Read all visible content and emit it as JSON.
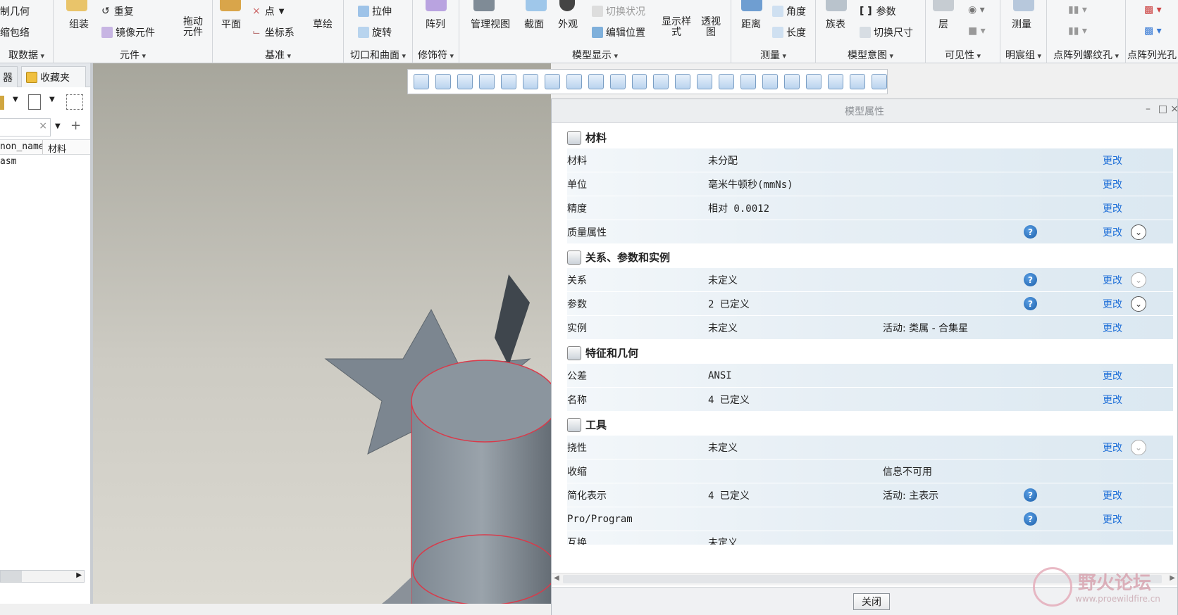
{
  "ribbon": {
    "groups": [
      {
        "label": "取数据",
        "items": [
          "制几何",
          "缩包络"
        ]
      },
      {
        "label": "元件",
        "items": [
          "组装",
          "重复",
          "镜像元件",
          "拖动元件"
        ]
      },
      {
        "label": "基准",
        "items": [
          "平面",
          "点",
          "坐标系",
          "草绘"
        ]
      },
      {
        "label": "切口和曲面",
        "items": [
          "拉伸",
          "旋转"
        ]
      },
      {
        "label": "修饰符",
        "items": [
          "阵列"
        ]
      },
      {
        "label": "模型显示",
        "items": [
          "管理视图",
          "截面",
          "外观",
          "切换状况",
          "编辑位置",
          "显示样式",
          "透视图"
        ]
      },
      {
        "label": "测量",
        "items": [
          "距离",
          "角度",
          "长度"
        ]
      },
      {
        "label": "模型意图",
        "items": [
          "族表",
          "参数",
          "切换尺寸"
        ]
      },
      {
        "label": "可见性",
        "items": [
          "层"
        ]
      },
      {
        "label": "明宸组",
        "items": [
          "测量"
        ]
      },
      {
        "label": "点阵列螺纹孔",
        "items": []
      },
      {
        "label": "点阵列光孔",
        "items": []
      }
    ]
  },
  "left_panel": {
    "tabs": [
      "器",
      "收藏夹"
    ],
    "columns": [
      "non_name",
      "材料"
    ],
    "rows": [
      "asm"
    ]
  },
  "dialog": {
    "title": "模型属性",
    "close_label": "关闭",
    "change_label": "更改",
    "sections": [
      {
        "title": "材料",
        "rows": [
          {
            "label": "材料",
            "value": "未分配",
            "extra": ""
          },
          {
            "label": "单位",
            "value": "毫米牛顿秒(mmNs)",
            "extra": ""
          },
          {
            "label": "精度",
            "value": "相对 0.0012",
            "extra": ""
          },
          {
            "label": "质量属性",
            "value": "",
            "extra": ""
          }
        ]
      },
      {
        "title": "关系、参数和实例",
        "rows": [
          {
            "label": "关系",
            "value": "未定义",
            "extra": ""
          },
          {
            "label": "参数",
            "value": "2 已定义",
            "extra": ""
          },
          {
            "label": "实例",
            "value": "未定义",
            "extra": "活动: 类属 - 合集星"
          }
        ]
      },
      {
        "title": "特征和几何",
        "rows": [
          {
            "label": "公差",
            "value": "ANSI",
            "extra": ""
          },
          {
            "label": "名称",
            "value": "4 已定义",
            "extra": ""
          }
        ]
      },
      {
        "title": "工具",
        "rows": [
          {
            "label": "挠性",
            "value": "未定义",
            "extra": ""
          },
          {
            "label": "收缩",
            "value": "",
            "extra": "信息不可用"
          },
          {
            "label": "简化表示",
            "value": "4 已定义",
            "extra": "活动: 主表示"
          },
          {
            "label": "Pro/Program",
            "value": "",
            "extra": ""
          },
          {
            "label": "互换",
            "value": "未定义",
            "extra": ""
          }
        ]
      }
    ]
  },
  "watermark": {
    "title": "野火论坛",
    "url": "www.proewildfire.cn"
  }
}
